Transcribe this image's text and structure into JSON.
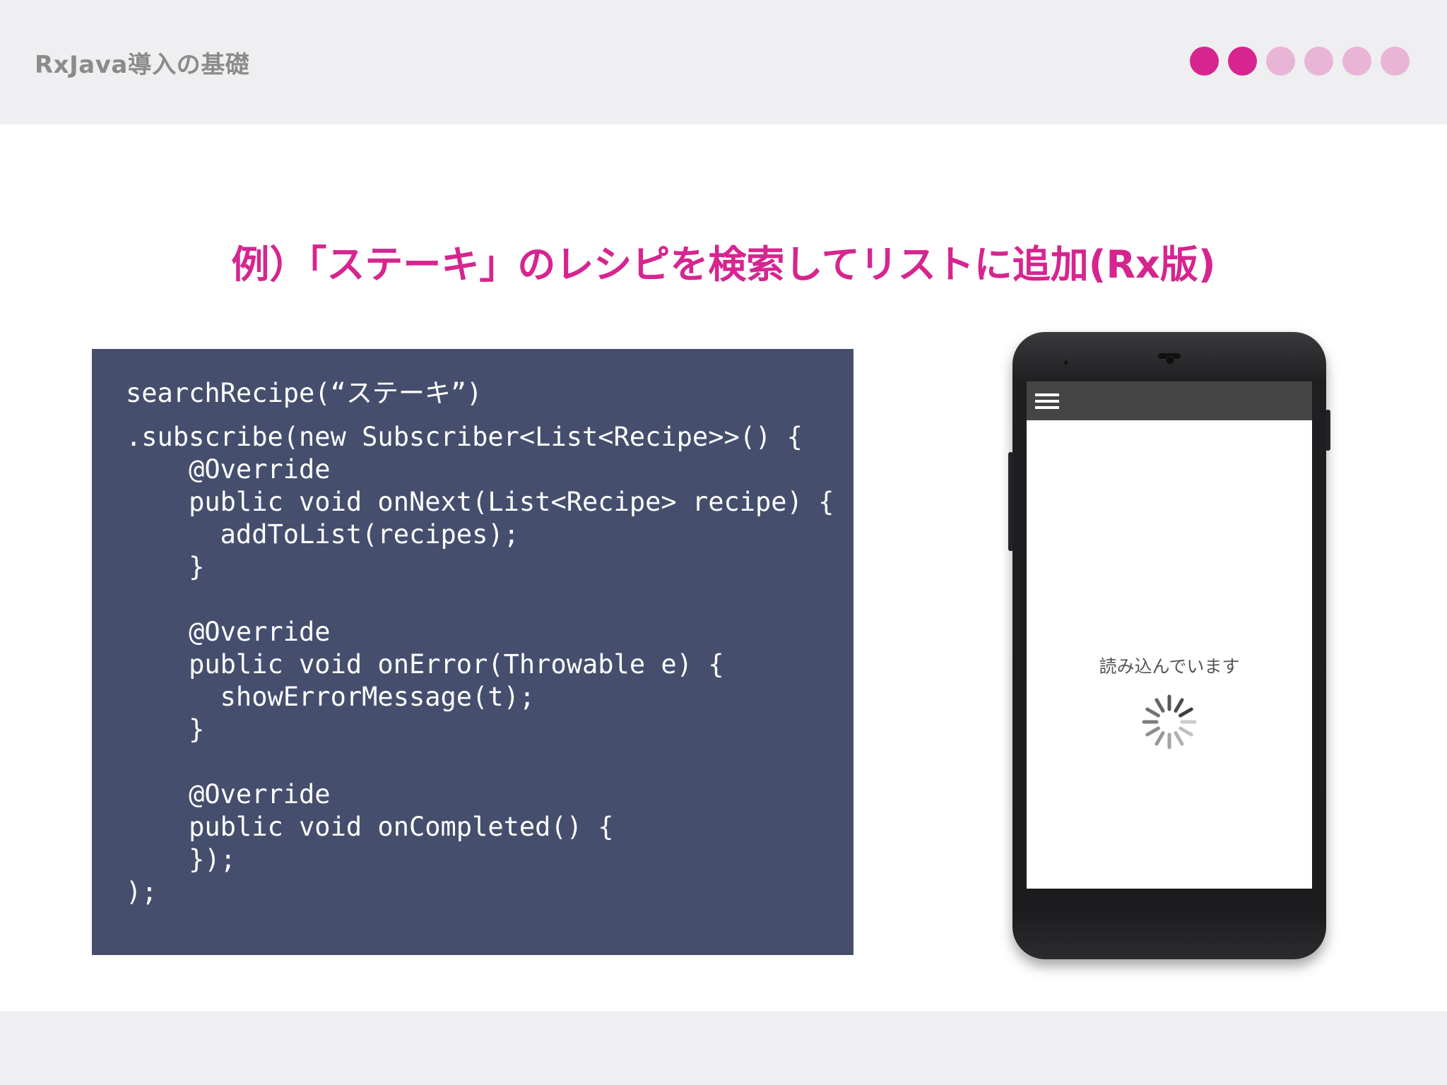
{
  "header": {
    "deck_title": "RxJava導入の基礎",
    "progress": {
      "total": 6,
      "active": 2,
      "active_color": "#d6258f",
      "inactive_color": "#e8b5d6"
    }
  },
  "slide": {
    "heading": "例）「ステーキ」のレシピを検索してリストに追加(Rx版)",
    "heading_color": "#d6258f"
  },
  "code": {
    "background": "#454e6d",
    "lines": [
      "searchRecipe(“ステーキ”)",
      ".subscribe(new Subscriber<List<Recipe>>() {",
      "    @Override",
      "    public void onNext(List<Recipe> recipe) {",
      "      addToList(recipes);",
      "    }",
      "",
      "    @Override",
      "    public void onError(Throwable e) {",
      "      showErrorMessage(t);",
      "    }",
      "",
      "    @Override",
      "    public void onCompleted() {",
      "    });",
      ");"
    ]
  },
  "phone": {
    "menu_icon": "hamburger-menu-icon",
    "loading_text": "読み込んでいます",
    "spinner_icon": "loading-spinner-icon"
  }
}
